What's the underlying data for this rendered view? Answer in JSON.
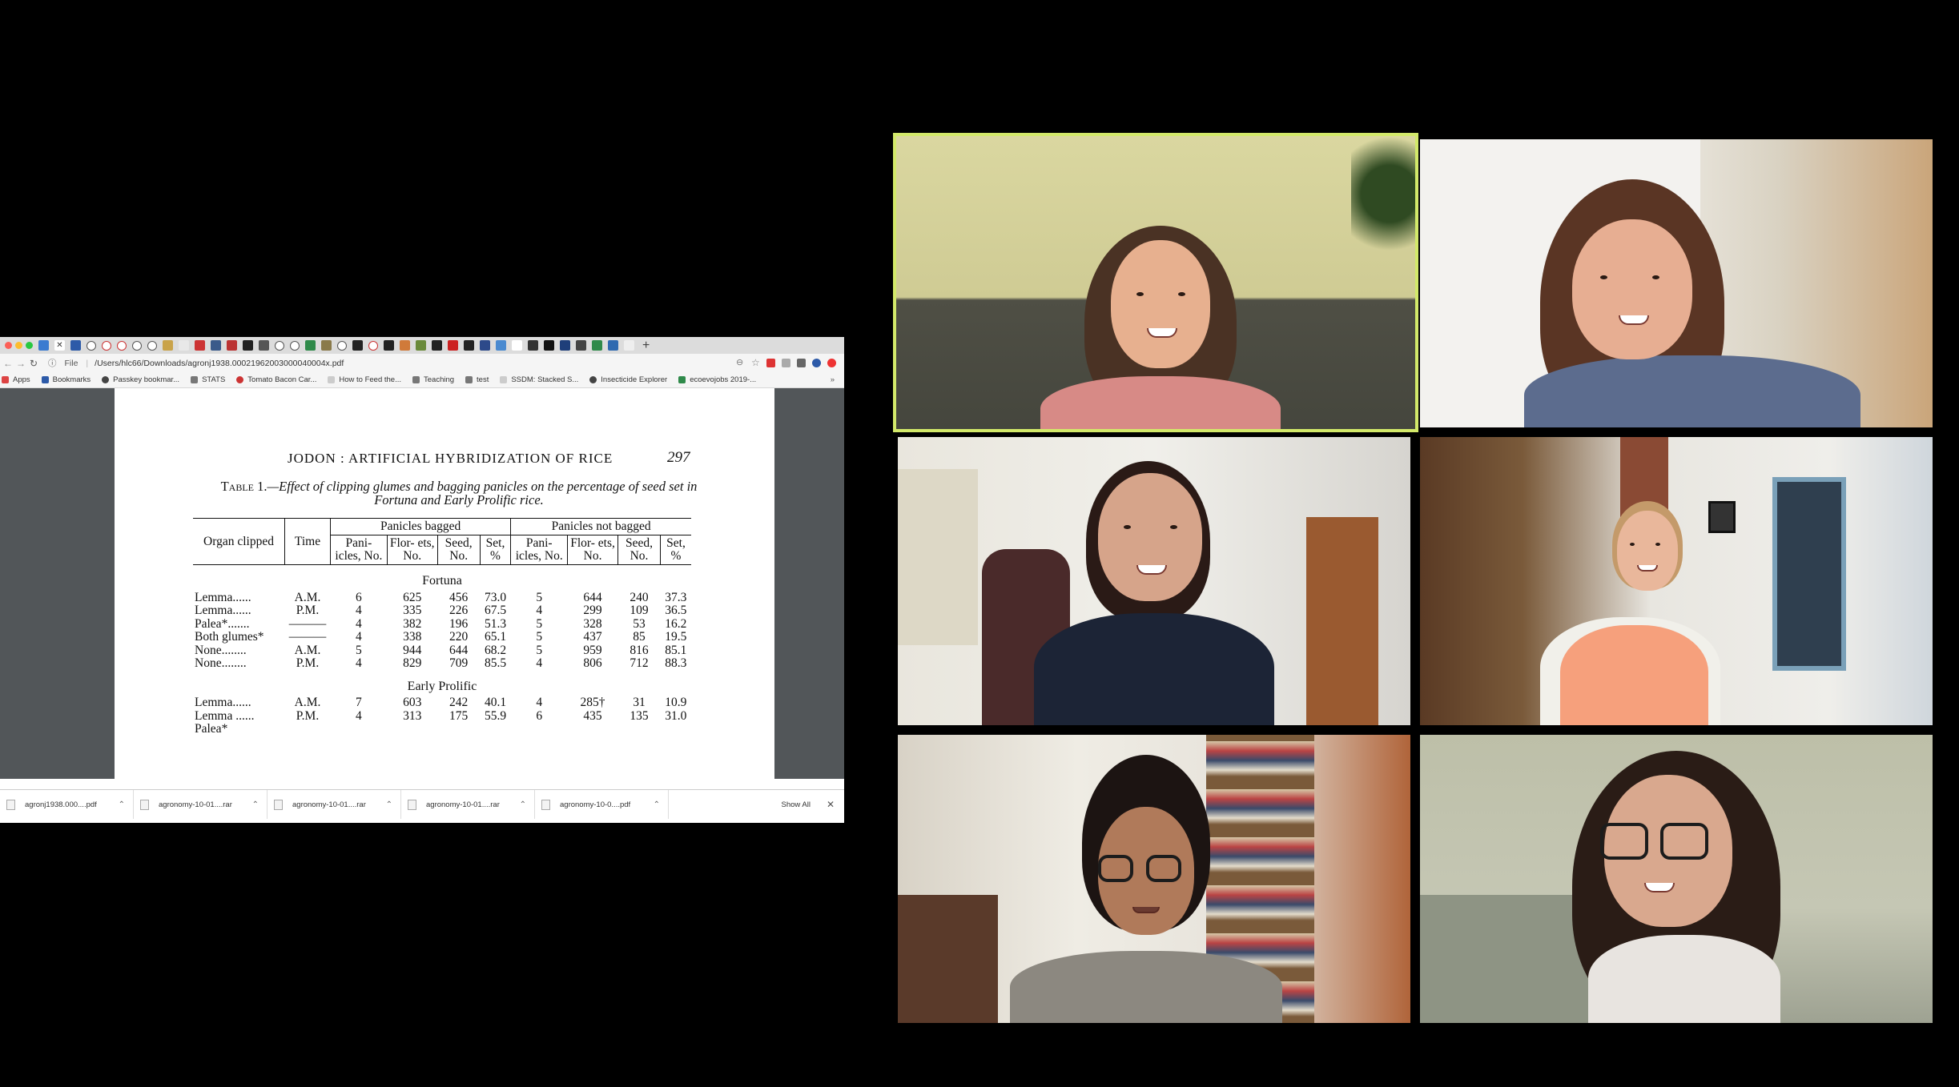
{
  "browser": {
    "url": "/Users/hlc66/Downloads/agronj1938.00021962003000040004x.pdf",
    "url_scheme_label": "File",
    "bookmarks": [
      "Apps",
      "Bookmarks",
      "Passkey bookmar...",
      "STATS",
      "Tomato Bacon Car...",
      "How to Feed the...",
      "Teaching",
      "test",
      "SSDM: Stacked S...",
      "Insecticide Explorer",
      "ecoevojobs 2019-..."
    ],
    "bookmark_overflow": "»",
    "new_tab": "+"
  },
  "pdf": {
    "running_head": "JODON : ARTIFICIAL HYBRIDIZATION OF RICE",
    "page_number": "297",
    "table_label": "Table 1.",
    "table_caption": "—Effect of clipping glumes and bagging panicles on the percentage of seed set in Fortuna and Early Prolific rice.",
    "headers": {
      "organ": "Organ clipped",
      "time": "Time",
      "bagged": "Panicles bagged",
      "not_bagged": "Panicles not bagged",
      "sub": [
        "Pani- icles, No.",
        "Flor- ets, No.",
        "Seed, No.",
        "Set, %",
        "Pani- icles, No.",
        "Flor- ets, No.",
        "Seed, No.",
        "Set, %"
      ]
    },
    "sections": [
      {
        "name": "Fortuna",
        "rows": [
          [
            "Lemma......",
            "A.M.",
            "6",
            "625",
            "456",
            "73.0",
            "5",
            "644",
            "240",
            "37.3"
          ],
          [
            "Lemma......",
            "P.M.",
            "4",
            "335",
            "226",
            "67.5",
            "4",
            "299",
            "109",
            "36.5"
          ],
          [
            "Palea*.......",
            "———",
            "4",
            "382",
            "196",
            "51.3",
            "5",
            "328",
            "53",
            "16.2"
          ],
          [
            "Both glumes*",
            "———",
            "4",
            "338",
            "220",
            "65.1",
            "5",
            "437",
            "85",
            "19.5"
          ],
          [
            "None........",
            "A.M.",
            "5",
            "944",
            "644",
            "68.2",
            "5",
            "959",
            "816",
            "85.1"
          ],
          [
            "None........",
            "P.M.",
            "4",
            "829",
            "709",
            "85.5",
            "4",
            "806",
            "712",
            "88.3"
          ]
        ]
      },
      {
        "name": "Early Prolific",
        "rows": [
          [
            "Lemma......",
            "A.M.",
            "7",
            "603",
            "242",
            "40.1",
            "4",
            "285†",
            "31",
            "10.9"
          ],
          [
            "Lemma ......",
            "P.M.",
            "4",
            "313",
            "175",
            "55.9",
            "6",
            "435",
            "135",
            "31.0"
          ],
          [
            "Palea*",
            "",
            "",
            "",
            "",
            "",
            "",
            "",
            "",
            ""
          ]
        ]
      }
    ]
  },
  "downloads": {
    "items": [
      "agronj1938.000....pdf",
      "agronomy-10-01....rar",
      "agronomy-10-01....rar",
      "agronomy-10-01....rar",
      "agronomy-10-0....pdf"
    ],
    "show_all": "Show All",
    "close": "✕"
  },
  "colors": {
    "active_speaker_border": "#d3e96a",
    "background": "#000000"
  }
}
